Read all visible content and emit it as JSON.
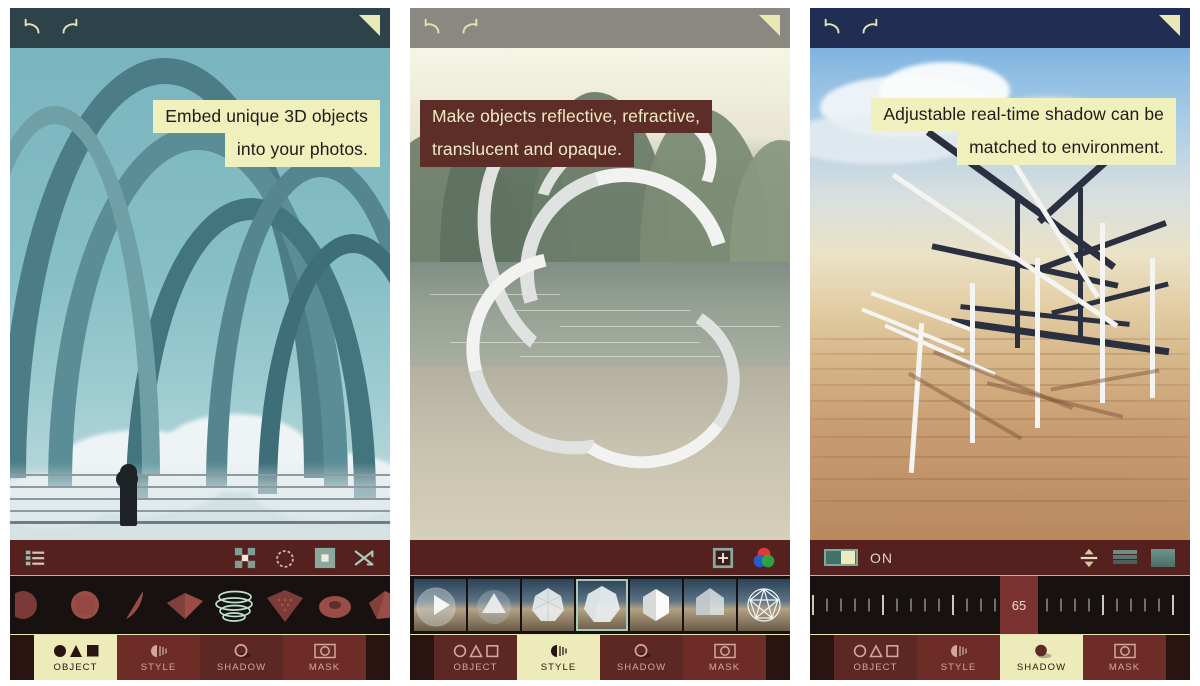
{
  "app": {
    "panels": [
      {
        "id": "panel-object",
        "caption_lines": [
          "Embed unique 3D objects",
          "into your photos."
        ],
        "caption_style": "cream",
        "topbar_color": "#2e4249",
        "icons": {
          "undo": "undo-icon",
          "redo": "redo-icon",
          "corner_flag": "corner-flag-icon"
        },
        "option_bar": {
          "left_icon": "list-icon",
          "right_icons": [
            "move-icon",
            "rotate-icon",
            "scale-icon",
            "shuffle-icon"
          ]
        },
        "strip_type": "objects",
        "objects": [
          {
            "name": "object-thumb-sphere-partial",
            "selected": false
          },
          {
            "name": "object-thumb-sphere",
            "selected": false
          },
          {
            "name": "object-thumb-lens",
            "selected": false
          },
          {
            "name": "object-thumb-pyramid",
            "selected": false
          },
          {
            "name": "object-thumb-rings",
            "selected": true
          },
          {
            "name": "object-thumb-mesh-cone",
            "selected": false
          },
          {
            "name": "object-thumb-torus",
            "selected": false
          },
          {
            "name": "object-thumb-polyhedron",
            "selected": false
          },
          {
            "name": "object-thumb-partial",
            "selected": false
          }
        ],
        "tabs": [
          {
            "label": "OBJECT",
            "icon": "shapes-filled-icon",
            "active": true
          },
          {
            "label": "STYLE",
            "icon": "sphere-shading-icon",
            "active": false
          },
          {
            "label": "SHADOW",
            "icon": "circle-shadow-icon",
            "active": false
          },
          {
            "label": "MASK",
            "icon": "mask-frame-icon",
            "active": false
          }
        ]
      },
      {
        "id": "panel-style",
        "caption_lines": [
          "Make objects reflective, refractive,",
          "translucent and opaque."
        ],
        "caption_style": "maroon",
        "topbar_color": "#8a8881",
        "icons": {
          "undo": "undo-icon",
          "redo": "redo-icon",
          "corner_flag": "corner-flag-icon"
        },
        "option_bar": {
          "right_icons": [
            "add-icon",
            "color-wheel-icon"
          ]
        },
        "strip_type": "styles",
        "styles": [
          {
            "name": "style-thumb-mirror-cone",
            "selected": false
          },
          {
            "name": "style-thumb-glass-pyramid",
            "selected": false
          },
          {
            "name": "style-thumb-frosted-polyhedron",
            "selected": false
          },
          {
            "name": "style-thumb-translucent-sphere",
            "selected": true
          },
          {
            "name": "style-thumb-opaque-white",
            "selected": false
          },
          {
            "name": "style-thumb-matte-grey",
            "selected": false
          },
          {
            "name": "style-thumb-wireframe",
            "selected": false
          }
        ],
        "tabs": [
          {
            "label": "OBJECT",
            "icon": "shapes-outline-icon",
            "active": false
          },
          {
            "label": "STYLE",
            "icon": "sphere-shading-icon",
            "active": true
          },
          {
            "label": "SHADOW",
            "icon": "circle-shadow-icon",
            "active": false
          },
          {
            "label": "MASK",
            "icon": "mask-frame-icon",
            "active": false
          }
        ]
      },
      {
        "id": "panel-shadow",
        "caption_lines": [
          "Adjustable real-time shadow can be",
          "matched to environment."
        ],
        "caption_style": "cream",
        "topbar_color": "#1f2e52",
        "icons": {
          "undo": "undo-icon",
          "redo": "redo-icon",
          "corner_flag": "corner-flag-icon"
        },
        "option_bar": {
          "toggle_state": "ON",
          "toggle_label": "ON",
          "right_icons": [
            "height-adjust-icon",
            "softness-icon",
            "opacity-swatch-icon"
          ]
        },
        "strip_type": "ruler",
        "ruler": {
          "value": "65",
          "min": 0,
          "max": 100,
          "major_every": 5,
          "total_ticks": 30
        },
        "tabs": [
          {
            "label": "OBJECT",
            "icon": "shapes-outline-icon",
            "active": false
          },
          {
            "label": "STYLE",
            "icon": "sphere-shading-icon",
            "active": false
          },
          {
            "label": "SHADOW",
            "icon": "shadow-filled-icon",
            "active": true
          },
          {
            "label": "MASK",
            "icon": "mask-frame-icon",
            "active": false
          }
        ]
      }
    ],
    "colors": {
      "caption_cream_bg": "#eff0bb",
      "caption_cream_text": "#1c1c1a",
      "caption_maroon_bg": "#5d2e28",
      "caption_maroon_text": "#efeac7",
      "optionbar_bg": "#55211f",
      "strip_bg": "#17120f",
      "tab_bg": "#6e2c27",
      "tab_active_bg": "#ecebb9",
      "tab_text": "#d0a8a2",
      "accent_teal": "#a9c9bd",
      "ruler_value_bg": "#7a3331"
    }
  }
}
